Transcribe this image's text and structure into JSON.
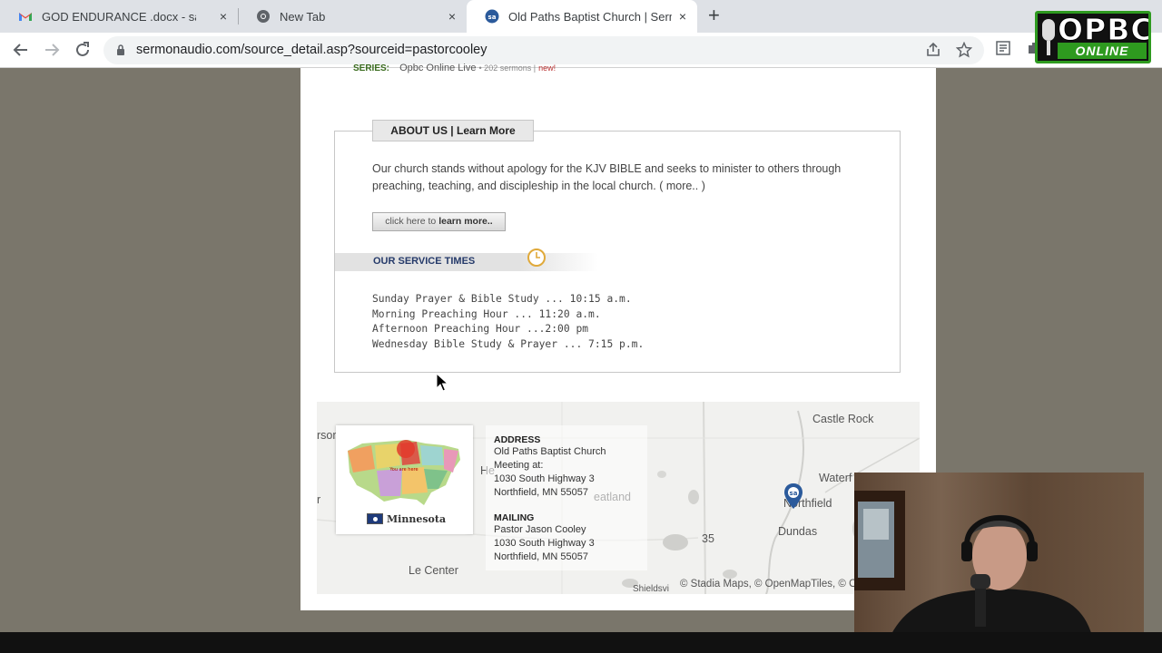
{
  "browser": {
    "tabs": [
      {
        "label": "GOD ENDURANCE .docx - salvati",
        "icon": "gmail-icon",
        "active": false
      },
      {
        "label": "New Tab",
        "icon": "chrome-icon",
        "active": false
      },
      {
        "label": "Old Paths Baptist Church | Sermo",
        "icon": "sermonaudio-icon",
        "active": true
      }
    ],
    "new_tab_symbol": "+",
    "close_symbol": "×",
    "url": "sermonaudio.com/source_detail.asp?sourceid=pastorcooley"
  },
  "logo": {
    "top": "OPBC",
    "bottom": "ONLINE"
  },
  "page": {
    "series": {
      "label": "SERIES:",
      "name": "Opbc Online Live",
      "count": "• 202 sermons |",
      "new": "new!"
    },
    "about": {
      "tab_title": "ABOUT US",
      "tab_sep": " | ",
      "tab_link": "Learn More",
      "text": "Our church stands without apology for the KJV BIBLE and seeks to minister to others through preaching, teaching, and discipleship in the local church.",
      "more": "( more.. )",
      "button_pre": "click here to ",
      "button_bold": "learn more.."
    },
    "service": {
      "title": "OUR SERVICE TIMES",
      "times": [
        "Sunday Prayer & Bible Study ... 10:15 a.m.",
        "Morning Preaching Hour ... 11:20 a.m.",
        "Afternoon Preaching Hour ...2:00 pm",
        "Wednesday Bible Study & Prayer ... 7:15 p.m."
      ]
    },
    "map": {
      "labels": {
        "castle_rock": "Castle Rock",
        "waterford": "Waterf",
        "northfield": "Northfield",
        "dundas": "Dundas",
        "le_center": "Le Center",
        "route": "35",
        "rson": "rson",
        "he": "He",
        "eatland": "eatland",
        "r": "r",
        "shieldsv": "Shieldsvi"
      },
      "attribution": "© Stadia Maps, © OpenMapTiles, © Op",
      "state": "Minnesota",
      "state_card_mini": "You are here",
      "address_heading": "ADDRESS",
      "address_lines": [
        "Old Paths Baptist Church",
        "Meeting at:",
        "1030 South Highway 3",
        "Northfield, MN 55057"
      ],
      "mailing_heading": "MAILING",
      "mailing_lines": [
        "Pastor Jason Cooley",
        "1030 South Highway 3",
        "Northfield, MN 55057"
      ]
    }
  },
  "colors": {
    "background": "#7a766b",
    "logo_green": "#2e9a1f",
    "service_title": "#253a6a",
    "series_green": "#3a6b1e"
  }
}
